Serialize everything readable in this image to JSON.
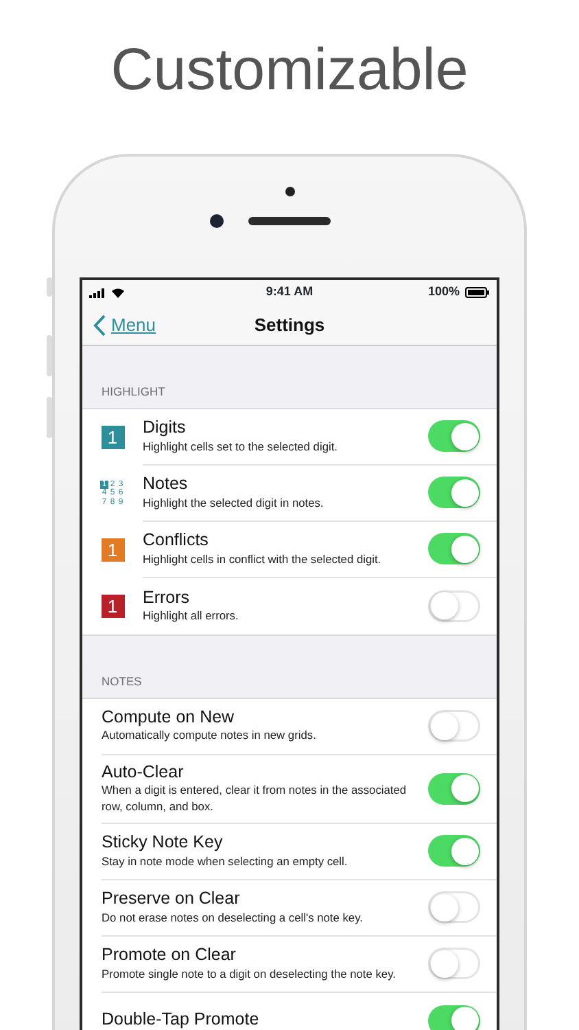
{
  "headline": "Customizable",
  "status_bar": {
    "time": "9:41 AM",
    "battery": "100%"
  },
  "nav": {
    "back": "Menu",
    "title": "Settings"
  },
  "sections": [
    {
      "header": "HIGHLIGHT",
      "rows": [
        {
          "kind": "icon",
          "icon": {
            "kind": "digit",
            "digit": "1",
            "color": "#2e8f9a"
          },
          "title": "Digits",
          "subtitle": "Highlight cells set to the selected digit.",
          "on": true
        },
        {
          "kind": "icon",
          "icon": {
            "kind": "notes",
            "digits": [
              {
                "text": "1",
                "selected": true
              },
              {
                "text": "2",
                "selected": false
              },
              {
                "text": "3",
                "selected": false
              },
              {
                "text": "4",
                "selected": false
              },
              {
                "text": "5",
                "selected": false
              },
              {
                "text": "6",
                "selected": false
              },
              {
                "text": "7",
                "selected": false
              },
              {
                "text": "8",
                "selected": false
              },
              {
                "text": "9",
                "selected": false
              }
            ]
          },
          "title": "Notes",
          "subtitle": "Highlight the selected digit in notes.",
          "on": true
        },
        {
          "kind": "icon",
          "icon": {
            "kind": "digit",
            "digit": "1",
            "color": "#e37b24"
          },
          "title": "Conflicts",
          "subtitle": "Highlight cells in conflict with the selected digit.",
          "on": true
        },
        {
          "kind": "icon",
          "icon": {
            "kind": "digit",
            "digit": "1",
            "color": "#b8202a"
          },
          "title": "Errors",
          "subtitle": "Highlight all errors.",
          "on": false
        }
      ]
    },
    {
      "header": "NOTES",
      "rows": [
        {
          "kind": "plain",
          "title": "Compute on New",
          "subtitle": "Automatically compute notes in new grids.",
          "on": false
        },
        {
          "kind": "plain",
          "title": "Auto-Clear",
          "subtitle": "When a digit is entered, clear it from notes in the associated row, column, and box.",
          "on": true
        },
        {
          "kind": "plain",
          "title": "Sticky Note Key",
          "subtitle": "Stay in note mode when selecting an empty cell.",
          "on": true
        },
        {
          "kind": "plain",
          "title": "Preserve on Clear",
          "subtitle": "Do not erase notes on deselecting a cell's note key.",
          "on": false
        },
        {
          "kind": "plain",
          "title": "Promote on Clear",
          "subtitle": "Promote single note to a digit on deselecting the note key.",
          "on": false
        },
        {
          "kind": "plain",
          "title": "Double-Tap Promote",
          "on": true
        }
      ]
    }
  ]
}
